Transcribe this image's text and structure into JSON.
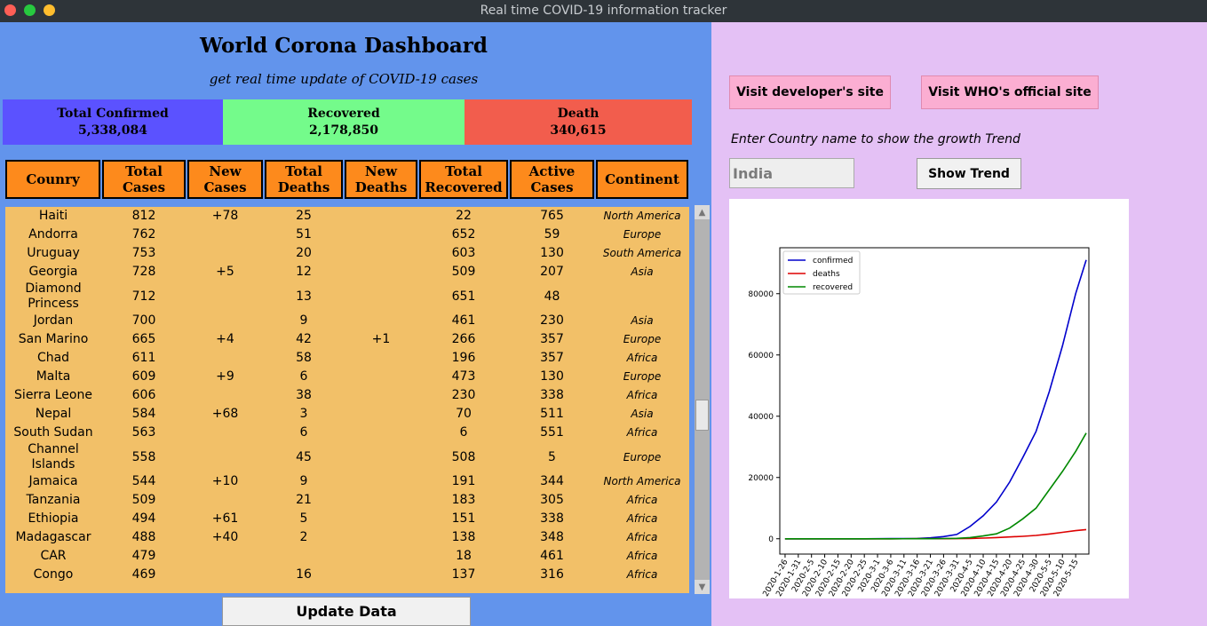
{
  "window": {
    "title": "Real time COVID-19 information tracker"
  },
  "dashboard": {
    "title": "World Corona Dashboard",
    "subtitle": "get real time update of COVID-19 cases"
  },
  "stats": {
    "confirmed": {
      "label": "Total Confirmed",
      "value": "5,338,084",
      "color": "#5b52ff"
    },
    "recovered": {
      "label": "Recovered",
      "value": "2,178,850",
      "color": "#74fb8b"
    },
    "death": {
      "label": "Death",
      "value": "340,615",
      "color": "#f25d4d"
    }
  },
  "table": {
    "headers": [
      "Counry",
      "Total Cases",
      "New Cases",
      "Total Deaths",
      "New Deaths",
      "Total Recovered",
      "Active Cases",
      "Continent"
    ],
    "rows": [
      [
        "Haiti",
        "812",
        "+78",
        "25",
        "",
        "22",
        "765",
        "North America"
      ],
      [
        "Andorra",
        "762",
        "",
        "51",
        "",
        "652",
        "59",
        "Europe"
      ],
      [
        "Uruguay",
        "753",
        "",
        "20",
        "",
        "603",
        "130",
        "South America"
      ],
      [
        "Georgia",
        "728",
        "+5",
        "12",
        "",
        "509",
        "207",
        "Asia"
      ],
      [
        "Diamond Princess",
        "712",
        "",
        "13",
        "",
        "651",
        "48",
        ""
      ],
      [
        "Jordan",
        "700",
        "",
        "9",
        "",
        "461",
        "230",
        "Asia"
      ],
      [
        "San Marino",
        "665",
        "+4",
        "42",
        "+1",
        "266",
        "357",
        "Europe"
      ],
      [
        "Chad",
        "611",
        "",
        "58",
        "",
        "196",
        "357",
        "Africa"
      ],
      [
        "Malta",
        "609",
        "+9",
        "6",
        "",
        "473",
        "130",
        "Europe"
      ],
      [
        "Sierra Leone",
        "606",
        "",
        "38",
        "",
        "230",
        "338",
        "Africa"
      ],
      [
        "Nepal",
        "584",
        "+68",
        "3",
        "",
        "70",
        "511",
        "Asia"
      ],
      [
        "South Sudan",
        "563",
        "",
        "6",
        "",
        "6",
        "551",
        "Africa"
      ],
      [
        "Channel Islands",
        "558",
        "",
        "45",
        "",
        "508",
        "5",
        "Europe"
      ],
      [
        "Jamaica",
        "544",
        "+10",
        "9",
        "",
        "191",
        "344",
        "North America"
      ],
      [
        "Tanzania",
        "509",
        "",
        "21",
        "",
        "183",
        "305",
        "Africa"
      ],
      [
        "Ethiopia",
        "494",
        "+61",
        "5",
        "",
        "151",
        "338",
        "Africa"
      ],
      [
        "Madagascar",
        "488",
        "+40",
        "2",
        "",
        "138",
        "348",
        "Africa"
      ],
      [
        "CAR",
        "479",
        "",
        "",
        "",
        "18",
        "461",
        "Africa"
      ],
      [
        "Congo",
        "469",
        "",
        "16",
        "",
        "137",
        "316",
        "Africa"
      ]
    ]
  },
  "buttons": {
    "update": "Update Data",
    "developer": "Visit developer's site",
    "who": "Visit WHO's official site",
    "show_trend": "Show Trend"
  },
  "trend": {
    "prompt": "Enter Country name to show the growth Trend",
    "country_value": "India"
  },
  "chart_data": {
    "type": "line",
    "title": "",
    "xlabel": "",
    "ylabel": "",
    "ylim": [
      -5000,
      95000
    ],
    "yticks": [
      0,
      20000,
      40000,
      60000,
      80000
    ],
    "xtick_labels": [
      "2020-1-26",
      "2020-1-31",
      "2020-2-5",
      "2020-2-10",
      "2020-2-15",
      "2020-2-20",
      "2020-2-25",
      "2020-3-1",
      "2020-3-6",
      "2020-3-11",
      "2020-3-16",
      "2020-3-21",
      "2020-3-26",
      "2020-3-31",
      "2020-4-5",
      "2020-4-10",
      "2020-4-15",
      "2020-4-20",
      "2020-4-25",
      "2020-4-30",
      "2020-5-5",
      "2020-5-10",
      "2020-5-15"
    ],
    "legend_position": "top-left",
    "x": [
      "2020-1-26",
      "2020-2-5",
      "2020-2-15",
      "2020-2-25",
      "2020-3-6",
      "2020-3-16",
      "2020-3-21",
      "2020-3-26",
      "2020-3-31",
      "2020-4-5",
      "2020-4-10",
      "2020-4-15",
      "2020-4-20",
      "2020-4-25",
      "2020-4-30",
      "2020-5-5",
      "2020-5-10",
      "2020-5-15",
      "2020-5-19"
    ],
    "series": [
      {
        "name": "confirmed",
        "color": "#0000cc",
        "values": [
          0,
          0,
          0,
          0,
          30,
          110,
          300,
          700,
          1400,
          4000,
          7500,
          12000,
          18500,
          26500,
          35000,
          48000,
          63000,
          80000,
          91000
        ]
      },
      {
        "name": "deaths",
        "color": "#dd0000",
        "values": [
          0,
          0,
          0,
          0,
          0,
          2,
          5,
          20,
          40,
          100,
          230,
          400,
          600,
          800,
          1100,
          1550,
          2100,
          2650,
          3000
        ]
      },
      {
        "name": "recovered",
        "color": "#008800",
        "values": [
          0,
          0,
          0,
          0,
          0,
          10,
          20,
          60,
          130,
          400,
          900,
          1600,
          3500,
          6500,
          10000,
          16000,
          22000,
          28500,
          34500
        ]
      }
    ]
  }
}
